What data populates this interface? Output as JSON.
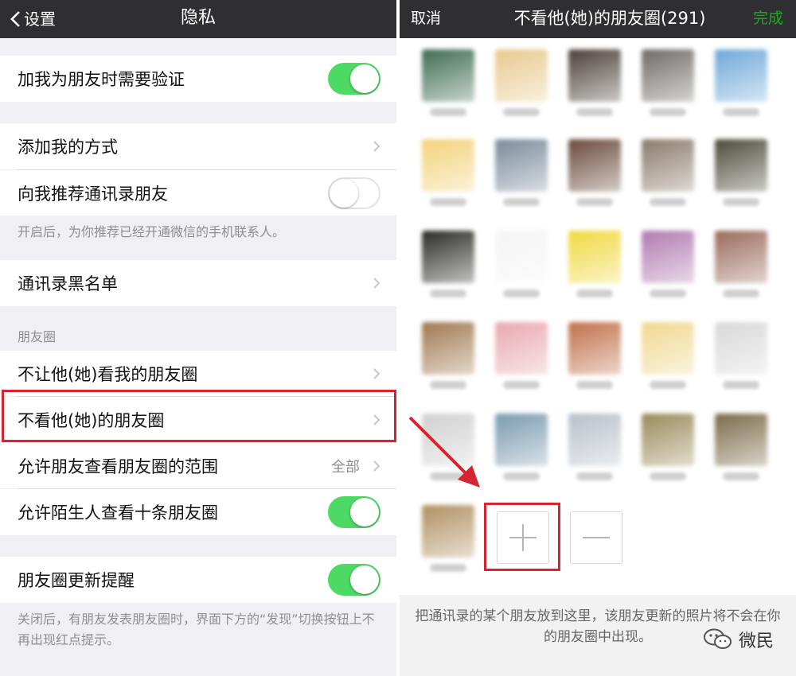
{
  "left": {
    "nav": {
      "back_label": "设置",
      "title": "隐私"
    },
    "rows": {
      "verify": "加我为朋友时需要验证",
      "add_methods": "添加我的方式",
      "recommend_contacts": "向我推荐通讯录朋友",
      "recommend_note": "开启后，为你推荐已经开通微信的手机联系人。",
      "blacklist": "通讯录黑名单",
      "moments_header": "朋友圈",
      "hide_my_moments": "不让他(她)看我的朋友圈",
      "dont_see_moments": "不看他(她)的朋友圈",
      "moments_range": "允许朋友查看朋友圈的范围",
      "moments_range_value": "全部",
      "stranger_ten": "允许陌生人查看十条朋友圈",
      "update_reminder": "朋友圈更新提醒",
      "update_note": "关闭后，有朋友发表朋友圈时，界面下方的“发现”切换按钮上不再出现红点提示。"
    },
    "toggles": {
      "verify": true,
      "recommend_contacts": false,
      "stranger_ten": true,
      "update_reminder": true
    }
  },
  "right": {
    "nav": {
      "cancel_label": "取消",
      "title": "不看他(她)的朋友圈(291)",
      "done_label": "完成"
    },
    "footer_text": "把通讯录的某个朋友放到这里，该朋友更新的照片将不会在你的朋友圈中出现。",
    "watermark": "微民",
    "avatar_colors": [
      "#3e6b52",
      "#e8c98e",
      "#4a4038",
      "#6f6a66",
      "#6fa8d8",
      "#f2d27a",
      "#7a8a9a",
      "#6a4a3a",
      "#8a7a6a",
      "#4a4a3a",
      "#2a2a24",
      "#f4f4f4",
      "#f0d840",
      "#b07ab0",
      "#9a6a5a",
      "#a07850",
      "#e8a8b0",
      "#c0704a",
      "#f0d890",
      "#d8d8d8",
      "#d0d0d0",
      "#7a9ab0",
      "#b8c0c8",
      "#9a8a5a",
      "#7a6a48",
      "#b09060"
    ]
  },
  "colors": {
    "accent_green": "#4cd964",
    "highlight_red": "#d42532",
    "done_green": "#1aad19"
  }
}
